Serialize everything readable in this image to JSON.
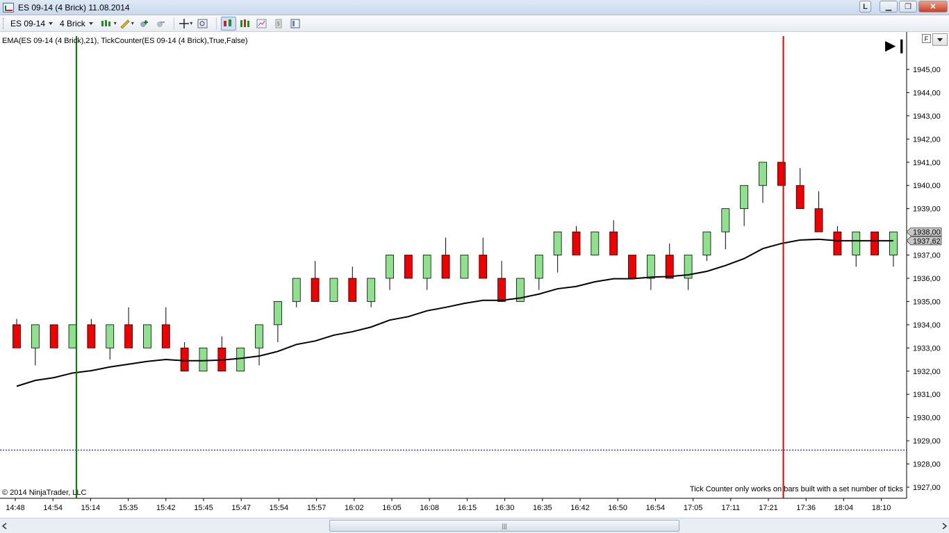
{
  "window": {
    "title": "ES 09-14 (4 Brick)  11.08.2014"
  },
  "toolbar": {
    "instrument": "ES 09-14",
    "period": "4 Brick"
  },
  "chart": {
    "indicator_label": "EMA(ES 09-14 (4 Brick),21), TickCounter(ES 09-14 (4 Brick),True,False)",
    "copyright": "© 2014 NinjaTrader, LLC",
    "tick_counter_note": "Tick Counter only works on bars built with a set number of ticks",
    "f_label": "F",
    "colors": {
      "up": "#90e090",
      "down": "#ee0000",
      "ema": "#000000",
      "vline_left": "#007700",
      "vline_right": "#dd0000",
      "hline": "#00008b"
    }
  },
  "chart_data": {
    "type": "candlestick",
    "ylim": [
      1926.8,
      1946.5
    ],
    "y_ticks": [
      "1927,00",
      "1928,00",
      "1929,00",
      "1930,00",
      "1931,00",
      "1932,00",
      "1933,00",
      "1934,00",
      "1935,00",
      "1936,00",
      "1937,00",
      "1938,00",
      "1939,00",
      "1940,00",
      "1941,00",
      "1942,00",
      "1943,00",
      "1944,00",
      "1945,00"
    ],
    "y_tick_values": [
      1927,
      1928,
      1929,
      1930,
      1931,
      1932,
      1933,
      1934,
      1935,
      1936,
      1937,
      1938,
      1939,
      1940,
      1941,
      1942,
      1943,
      1944,
      1945
    ],
    "x_labels": [
      "14:48",
      "14:54",
      "15:14",
      "15:35",
      "15:42",
      "15:45",
      "15:47",
      "15:54",
      "15:57",
      "16:02",
      "16:05",
      "16:08",
      "16:15",
      "16:30",
      "16:35",
      "16:42",
      "16:50",
      "16:54",
      "17:05",
      "17:11",
      "17:21",
      "17:36",
      "18:04",
      "18:10"
    ],
    "bars": [
      {
        "o": 1934,
        "c": 1933,
        "h": 1934.25,
        "l": 1933
      },
      {
        "o": 1933,
        "c": 1934,
        "h": 1934,
        "l": 1932.25
      },
      {
        "o": 1934,
        "c": 1933,
        "h": 1934,
        "l": 1933
      },
      {
        "o": 1933,
        "c": 1934,
        "h": 1934,
        "l": 1933
      },
      {
        "o": 1934,
        "c": 1933,
        "h": 1934.25,
        "l": 1933
      },
      {
        "o": 1933,
        "c": 1934,
        "h": 1934,
        "l": 1932.5
      },
      {
        "o": 1934,
        "c": 1933,
        "h": 1934.75,
        "l": 1933
      },
      {
        "o": 1933,
        "c": 1934,
        "h": 1934,
        "l": 1933
      },
      {
        "o": 1934,
        "c": 1933,
        "h": 1934.75,
        "l": 1933
      },
      {
        "o": 1933,
        "c": 1932,
        "h": 1933.25,
        "l": 1932
      },
      {
        "o": 1932,
        "c": 1933,
        "h": 1933,
        "l": 1932
      },
      {
        "o": 1933,
        "c": 1932,
        "h": 1933.5,
        "l": 1932
      },
      {
        "o": 1932,
        "c": 1933,
        "h": 1933,
        "l": 1932
      },
      {
        "o": 1933,
        "c": 1934,
        "h": 1934,
        "l": 1932.25
      },
      {
        "o": 1934,
        "c": 1935,
        "h": 1935,
        "l": 1933.25
      },
      {
        "o": 1935,
        "c": 1936,
        "h": 1936,
        "l": 1934.75
      },
      {
        "o": 1936,
        "c": 1935,
        "h": 1936.75,
        "l": 1935
      },
      {
        "o": 1935,
        "c": 1936,
        "h": 1936,
        "l": 1935
      },
      {
        "o": 1936,
        "c": 1935,
        "h": 1936.5,
        "l": 1935
      },
      {
        "o": 1935,
        "c": 1936,
        "h": 1936,
        "l": 1934.75
      },
      {
        "o": 1936,
        "c": 1937,
        "h": 1937,
        "l": 1935.5
      },
      {
        "o": 1937,
        "c": 1936,
        "h": 1937,
        "l": 1936
      },
      {
        "o": 1936,
        "c": 1937,
        "h": 1937,
        "l": 1935.5
      },
      {
        "o": 1937,
        "c": 1936,
        "h": 1937.75,
        "l": 1936
      },
      {
        "o": 1936,
        "c": 1937,
        "h": 1937,
        "l": 1936
      },
      {
        "o": 1937,
        "c": 1936,
        "h": 1937.75,
        "l": 1936
      },
      {
        "o": 1936,
        "c": 1935,
        "h": 1936.75,
        "l": 1935
      },
      {
        "o": 1935,
        "c": 1936,
        "h": 1936,
        "l": 1935
      },
      {
        "o": 1936,
        "c": 1937,
        "h": 1937,
        "l": 1935.5
      },
      {
        "o": 1937,
        "c": 1938,
        "h": 1938,
        "l": 1936.25
      },
      {
        "o": 1938,
        "c": 1937,
        "h": 1938.25,
        "l": 1937
      },
      {
        "o": 1937,
        "c": 1938,
        "h": 1938,
        "l": 1937
      },
      {
        "o": 1938,
        "c": 1937,
        "h": 1938.5,
        "l": 1937
      },
      {
        "o": 1937,
        "c": 1936,
        "h": 1937,
        "l": 1936
      },
      {
        "o": 1936,
        "c": 1937,
        "h": 1937,
        "l": 1935.5
      },
      {
        "o": 1937,
        "c": 1936,
        "h": 1937.5,
        "l": 1936
      },
      {
        "o": 1936,
        "c": 1937,
        "h": 1937,
        "l": 1935.5
      },
      {
        "o": 1937,
        "c": 1938,
        "h": 1938,
        "l": 1936.75
      },
      {
        "o": 1938,
        "c": 1939,
        "h": 1939,
        "l": 1937.25
      },
      {
        "o": 1939,
        "c": 1940,
        "h": 1940,
        "l": 1938.25
      },
      {
        "o": 1940,
        "c": 1941,
        "h": 1941,
        "l": 1939.25
      },
      {
        "o": 1941,
        "c": 1940,
        "h": 1941,
        "l": 1940
      },
      {
        "o": 1940,
        "c": 1939,
        "h": 1940.75,
        "l": 1939
      },
      {
        "o": 1939,
        "c": 1938,
        "h": 1939.75,
        "l": 1938
      },
      {
        "o": 1938,
        "c": 1937,
        "h": 1938.25,
        "l": 1937
      },
      {
        "o": 1937,
        "c": 1938,
        "h": 1938,
        "l": 1936.5
      },
      {
        "o": 1938,
        "c": 1937,
        "h": 1938,
        "l": 1937
      },
      {
        "o": 1937,
        "c": 1938,
        "h": 1938,
        "l": 1936.5
      }
    ],
    "ema": [
      1931.35,
      1931.6,
      1931.72,
      1931.92,
      1932.02,
      1932.18,
      1932.3,
      1932.42,
      1932.5,
      1932.45,
      1932.45,
      1932.48,
      1932.55,
      1932.65,
      1932.85,
      1933.15,
      1933.3,
      1933.55,
      1933.7,
      1933.9,
      1934.2,
      1934.35,
      1934.6,
      1934.75,
      1934.92,
      1935.05,
      1935.05,
      1935.15,
      1935.32,
      1935.55,
      1935.65,
      1935.85,
      1935.98,
      1935.98,
      1936.05,
      1936.08,
      1936.15,
      1936.3,
      1936.55,
      1936.85,
      1937.28,
      1937.5,
      1937.65,
      1937.68,
      1937.62,
      1937.62,
      1937.62,
      1937.62
    ],
    "last_price_label": "1938,00",
    "ema_label": "1937,62",
    "hline_value": 1928.6,
    "vline_left_bar_index": 3.2,
    "vline_right_bar_index": 41.1
  }
}
